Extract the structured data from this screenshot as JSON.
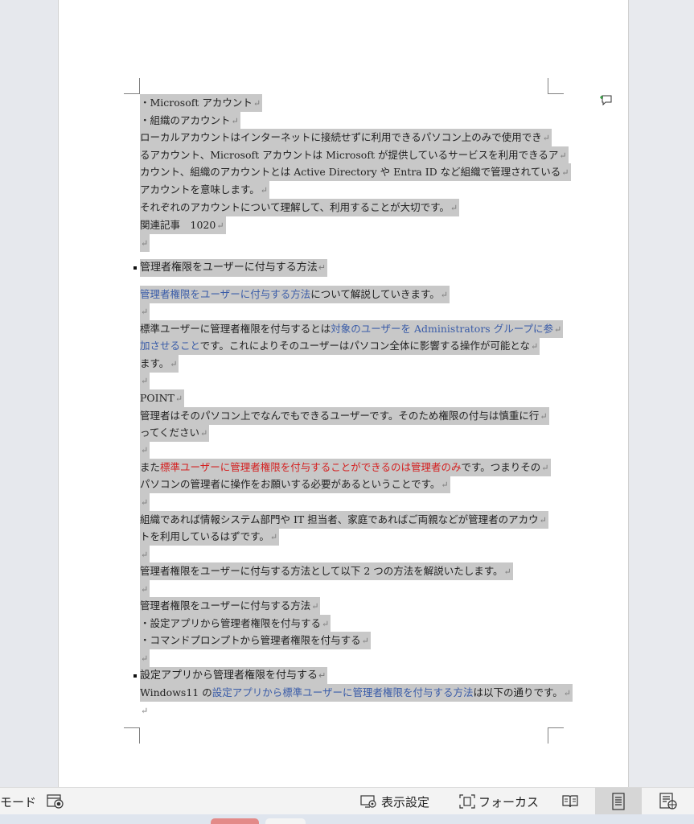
{
  "document": {
    "lines": [
      {
        "segments": [
          {
            "text": "・Microsoft アカウント"
          }
        ]
      },
      {
        "segments": [
          {
            "text": "・組織のアカウント"
          }
        ]
      },
      {
        "segments": [
          {
            "text": "ローカルアカウントはインターネットに接続せずに利用できるパソコン上のみで使用でき"
          }
        ]
      },
      {
        "segments": [
          {
            "text": "るアカウント、Microsoft アカウントは Microsoft が提供しているサービスを利用できるア"
          }
        ]
      },
      {
        "segments": [
          {
            "text": "カウント、組織のアカウントとは Active Directory や Entra ID など組織で管理されている"
          }
        ]
      },
      {
        "segments": [
          {
            "text": "アカウントを意味します。"
          }
        ]
      },
      {
        "segments": [
          {
            "text": "それぞれのアカウントについて理解して、利用することが大切です。"
          }
        ]
      },
      {
        "segments": [
          {
            "text": "関連記事　1020"
          }
        ]
      },
      {
        "segments": []
      },
      {
        "segments": [
          {
            "text": "管理者権限をユーザーに付与する方法"
          }
        ],
        "heading": true
      },
      {
        "segments": [
          {
            "text": "管理者権限をユーザーに付与する方法",
            "style": "blue"
          },
          {
            "text": "について解説していきます。"
          }
        ]
      },
      {
        "segments": []
      },
      {
        "segments": [
          {
            "text": "標準ユーザーに管理者権限を付与するとは"
          },
          {
            "text": "対象のユーザーを Administrators グループに参",
            "style": "blue"
          }
        ]
      },
      {
        "segments": [
          {
            "text": "加させること",
            "style": "blue"
          },
          {
            "text": "です。これによりそのユーザーはパソコン全体に影響する操作が可能とな"
          }
        ]
      },
      {
        "segments": [
          {
            "text": "ます。"
          }
        ]
      },
      {
        "segments": []
      },
      {
        "segments": [
          {
            "text": "POINT"
          }
        ]
      },
      {
        "segments": [
          {
            "text": "管理者はそのパソコン上でなんでもできるユーザーです。そのため権限の付与は慎重に行"
          }
        ]
      },
      {
        "segments": [
          {
            "text": "ってください"
          }
        ]
      },
      {
        "segments": []
      },
      {
        "segments": [
          {
            "text": "また"
          },
          {
            "text": "標準ユーザーに管理者権限を付与することができるのは管理者のみ",
            "style": "red"
          },
          {
            "text": "です。つまりその"
          }
        ]
      },
      {
        "segments": [
          {
            "text": "パソコンの管理者に操作をお願いする必要があるということです。"
          }
        ]
      },
      {
        "segments": []
      },
      {
        "segments": [
          {
            "text": "組織であれば情報システム部門や IT 担当者、家庭であればご両親などが管理者のアカウ"
          }
        ]
      },
      {
        "segments": [
          {
            "text": "トを利用しているはずです。"
          }
        ]
      },
      {
        "segments": []
      },
      {
        "segments": [
          {
            "text": "管理者権限をユーザーに付与する方法として以下 2 つの方法を解説いたします。"
          }
        ]
      },
      {
        "segments": []
      },
      {
        "segments": [
          {
            "text": "管理者権限をユーザーに付与する方法"
          }
        ]
      },
      {
        "segments": [
          {
            "text": "・設定アプリから管理者権限を付与する"
          }
        ]
      },
      {
        "segments": [
          {
            "text": "・コマンドプロンプトから管理者権限を付与する"
          }
        ]
      },
      {
        "segments": []
      },
      {
        "segments": [
          {
            "text": "設定アプリから管理者権限を付与する"
          }
        ],
        "heading": true
      },
      {
        "segments": [
          {
            "text": "Windows11 の"
          },
          {
            "text": "設定アプリから標準ユーザーに管理者権限を付与する方法",
            "style": "blue"
          },
          {
            "text": "は以下の通りです。"
          }
        ]
      },
      {
        "segments": [],
        "unhighlighted": true
      }
    ],
    "paragraph_mark": "↵"
  },
  "statusbar": {
    "mode_label": "モード",
    "display_settings_label": "表示設定",
    "focus_label": "フォーカス"
  },
  "colors": {
    "highlight": "#c8c8c8",
    "link_blue": "#3a5ca8",
    "emphasis_red": "#d42020"
  }
}
